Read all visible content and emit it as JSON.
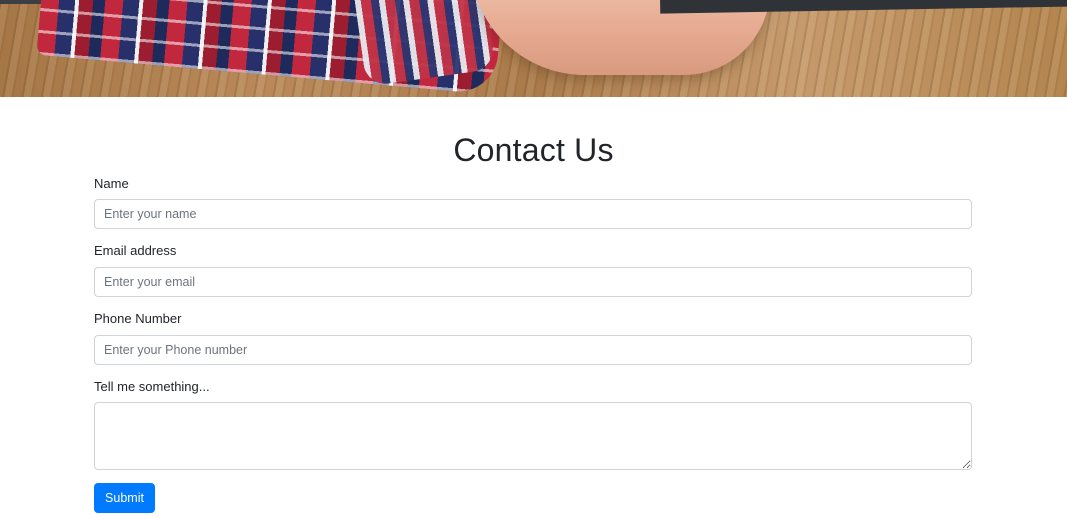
{
  "page": {
    "title": "Contact Us"
  },
  "colors": {
    "accent": "#007bff",
    "text": "#212529",
    "border": "#ced4da",
    "background": "#ffffff"
  },
  "form": {
    "name": {
      "label": "Name",
      "placeholder": "Enter your name",
      "value": ""
    },
    "email": {
      "label": "Email address",
      "placeholder": "Enter your email",
      "value": ""
    },
    "phone": {
      "label": "Phone Number",
      "placeholder": "Enter your Phone number",
      "value": ""
    },
    "message": {
      "label": "Tell me something...",
      "placeholder": "",
      "value": ""
    },
    "submit_label": "Submit"
  }
}
